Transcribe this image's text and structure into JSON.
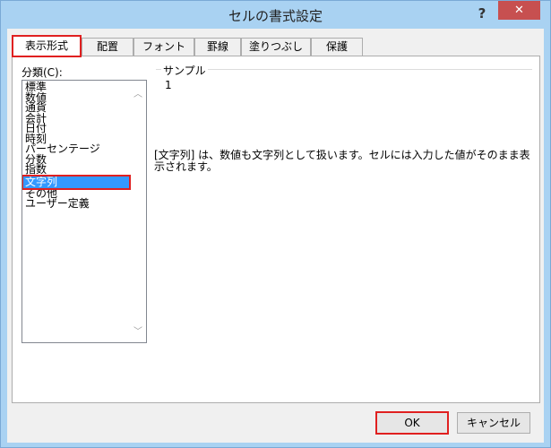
{
  "window": {
    "title": "セルの書式設定",
    "help_label": "?",
    "close_label": "✕"
  },
  "tabs": [
    {
      "label": "表示形式",
      "active": true
    },
    {
      "label": "配置",
      "active": false
    },
    {
      "label": "フォント",
      "active": false
    },
    {
      "label": "罫線",
      "active": false
    },
    {
      "label": "塗りつぶし",
      "active": false
    },
    {
      "label": "保護",
      "active": false
    }
  ],
  "category": {
    "label": "分類(C):",
    "items": [
      "標準",
      "数値",
      "通貨",
      "会計",
      "日付",
      "時刻",
      "パーセンテージ",
      "分数",
      "指数",
      "文字列",
      "その他",
      "ユーザー定義"
    ],
    "selected_index": 9
  },
  "sample": {
    "label": "サンプル",
    "value": "1"
  },
  "description": "[文字列] は、数値も文字列として扱います。セルには入力した値がそのまま表示されます。",
  "buttons": {
    "ok": "OK",
    "cancel": "キャンセル"
  },
  "colors": {
    "titlebar": "#a9d2f2",
    "close": "#c75050",
    "selection": "#3399ff",
    "highlight": "#e02020"
  }
}
